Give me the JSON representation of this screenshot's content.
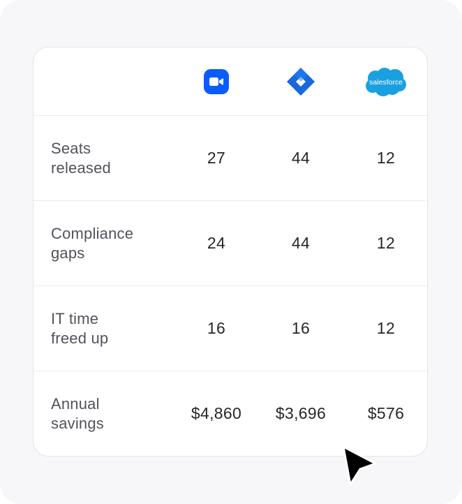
{
  "columns": [
    {
      "icon": "zoom-video-icon",
      "color": "#0b5cff"
    },
    {
      "icon": "jira-diamond-icon",
      "color": "#1868db"
    },
    {
      "icon": "salesforce-cloud-icon",
      "color": "#1aa0e0",
      "logo_text": "salesforce"
    }
  ],
  "rows": [
    {
      "label_line1": "Seats",
      "label_line2": "released",
      "values": [
        "27",
        "44",
        "12"
      ]
    },
    {
      "label_line1": "Compliance",
      "label_line2": "gaps",
      "values": [
        "24",
        "44",
        "12"
      ]
    },
    {
      "label_line1": "IT time",
      "label_line2": "freed up",
      "values": [
        "16",
        "16",
        "12"
      ]
    },
    {
      "label_line1": "Annual",
      "label_line2": "savings",
      "values": [
        "$4,860",
        "$3,696",
        "$576"
      ]
    }
  ],
  "cursor": "arrow-cursor-icon"
}
